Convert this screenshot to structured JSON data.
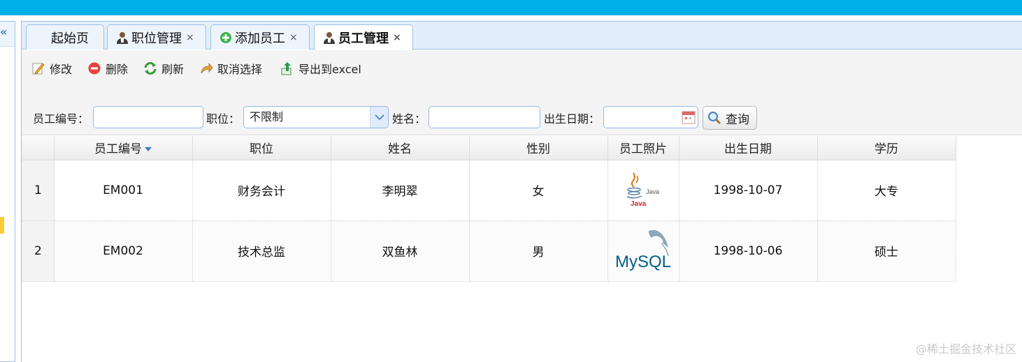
{
  "tabs": [
    {
      "label": "起始页",
      "icon": "none",
      "closable": false
    },
    {
      "label": "职位管理",
      "icon": "user-icon",
      "closable": true
    },
    {
      "label": "添加员工",
      "icon": "add-circle-icon",
      "closable": true
    },
    {
      "label": "员工管理",
      "icon": "user-icon",
      "closable": true,
      "active": true
    }
  ],
  "tab_close_glyph": "×",
  "left_panel": {
    "collapse_glyph": "«"
  },
  "toolbar": {
    "edit": "修改",
    "delete": "删除",
    "refresh": "刷新",
    "cancel_select": "取消选择",
    "export": "导出到excel"
  },
  "filters": {
    "emp_no_label": "员工编号：",
    "emp_no_value": "",
    "position_label": "职位：",
    "position_value": "不限制",
    "name_label": "姓名：",
    "name_value": "",
    "birth_label": "出生日期：",
    "birth_value": "",
    "search_button": "查询"
  },
  "grid": {
    "columns": [
      "员工编号",
      "职位",
      "姓名",
      "性别",
      "员工照片",
      "出生日期",
      "学历"
    ],
    "sorted_column": "员工编号",
    "rows": [
      {
        "rownum": "1",
        "emp_no": "EM001",
        "position": "财务会计",
        "name": "李明翠",
        "gender": "女",
        "photo": "java-logo",
        "birth": "1998-10-07",
        "education": "大专"
      },
      {
        "rownum": "2",
        "emp_no": "EM002",
        "position": "技术总监",
        "name": "双鱼林",
        "gender": "男",
        "photo": "mysql-logo",
        "birth": "1998-10-06",
        "education": "硕士"
      }
    ]
  },
  "photo_logos": {
    "java_text": "Java",
    "mysql_text": "MySQL"
  },
  "watermark": "@稀土掘金技术社区",
  "colors": {
    "topbar": "#00aee8",
    "border": "#9cc1ea",
    "sort_arrow": "#3a7ac7"
  }
}
